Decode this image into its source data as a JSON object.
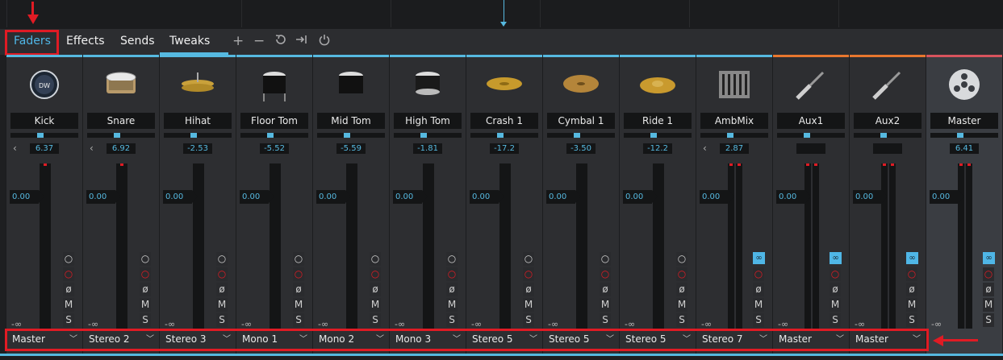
{
  "tabs": {
    "faders": "Faders",
    "effects": "Effects",
    "sends": "Sends",
    "tweaks": "Tweaks"
  },
  "toolbar_icons": [
    "plus-icon",
    "minus-icon",
    "undo-icon",
    "jump-end-icon",
    "power-icon"
  ],
  "colors": {
    "accent": "#56b9e0",
    "orange": "#e8772e",
    "red_marker": "#e01b24",
    "master_top": "#d9535d"
  },
  "meter_bottom_label": "-∞",
  "solo_mute": {
    "m": "M",
    "s": "S"
  },
  "channels": [
    {
      "name": "Kick",
      "gain": "6.37",
      "volume": "0.00",
      "output": "Master",
      "icon": "kick-drum-icon"
    },
    {
      "name": "Snare",
      "gain": "6.92",
      "volume": "0.00",
      "output": "Stereo 2",
      "icon": "snare-drum-icon"
    },
    {
      "name": "Hihat",
      "gain": "-2.53",
      "volume": "0.00",
      "output": "Stereo 3",
      "icon": "hihat-icon"
    },
    {
      "name": "Floor Tom",
      "gain": "-5.52",
      "volume": "0.00",
      "output": "Mono 1",
      "icon": "floor-tom-icon"
    },
    {
      "name": "Mid Tom",
      "gain": "-5.59",
      "volume": "0.00",
      "output": "Mono 2",
      "icon": "mid-tom-icon"
    },
    {
      "name": "High Tom",
      "gain": "-1.81",
      "volume": "0.00",
      "output": "Mono 3",
      "icon": "high-tom-icon"
    },
    {
      "name": "Crash 1",
      "gain": "-17.2",
      "volume": "0.00",
      "output": "Stereo 5",
      "icon": "crash-cymbal-icon"
    },
    {
      "name": "Cymbal 1",
      "gain": "-3.50",
      "volume": "0.00",
      "output": "Stereo 5",
      "icon": "cymbal-icon"
    },
    {
      "name": "Ride 1",
      "gain": "-12.2",
      "volume": "0.00",
      "output": "Stereo 5",
      "icon": "ride-cymbal-icon"
    },
    {
      "name": "AmbMix",
      "gain": "2.87",
      "volume": "0.00",
      "output": "Stereo 7",
      "icon": "mixer-icon"
    },
    {
      "name": "Aux1",
      "gain": "",
      "volume": "0.00",
      "output": "Master",
      "icon": "cable-icon"
    },
    {
      "name": "Aux2",
      "gain": "",
      "volume": "0.00",
      "output": "Master",
      "icon": "cable-icon"
    },
    {
      "name": "Master",
      "gain": "6.41",
      "volume": "0.00",
      "output": "",
      "icon": "reel-icon"
    }
  ]
}
